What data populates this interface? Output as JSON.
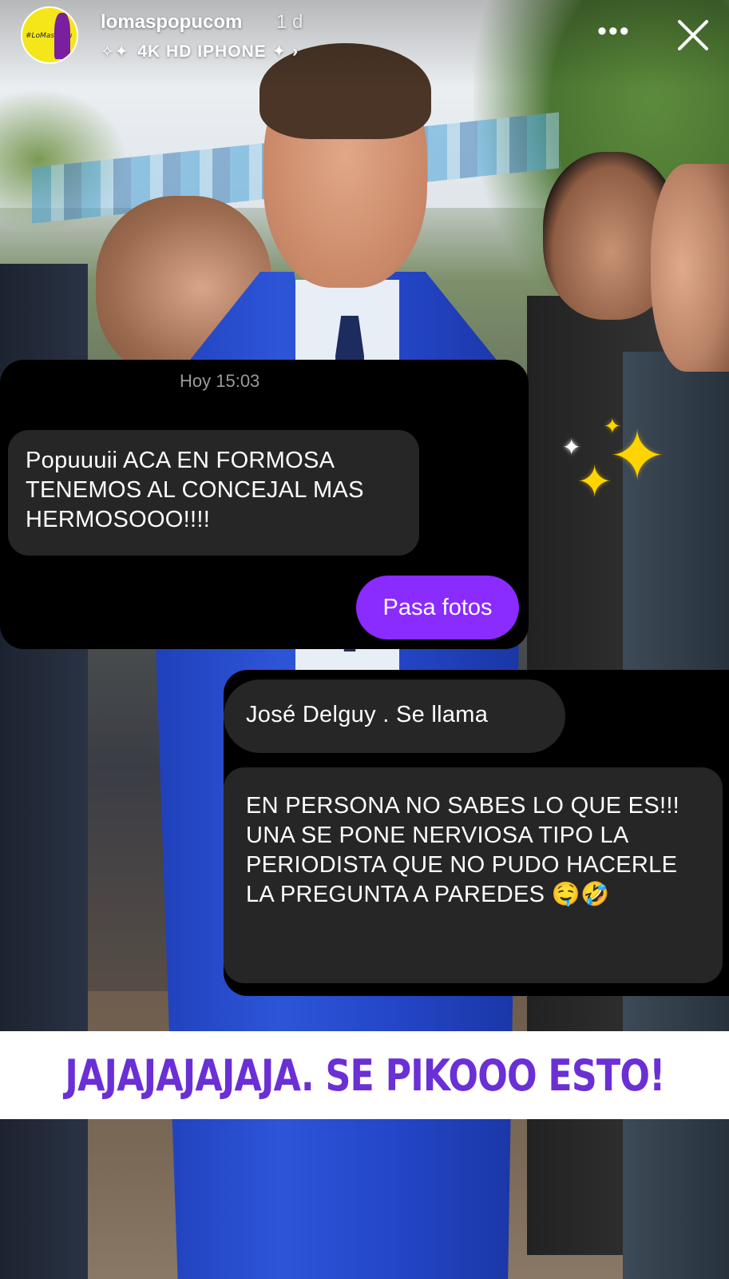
{
  "story": {
    "username": "lomaspopucom",
    "time_ago": "1 d",
    "music_label": "4K HD IPHONE",
    "avatar_text": "#LoMasPopu"
  },
  "chat": {
    "timestamp": "Hoy 15:03",
    "message_1": "Popuuuii ACA EN FORMOSA TENEMOS AL CONCEJAL MAS HERMOSOOO!!!!",
    "reply": "Pasa fotos",
    "message_2": "José Delguy . Se llama",
    "message_3": "EN PERSONA NO SABES LO QUE ES!!! UNA SE PONE NERVIOSA TIPO LA PERIODISTA  QUE NO PUDO HACERLE LA PREGUNTA A PAREDES 🤤🤣"
  },
  "banner": {
    "text": "JAJAJAJAJAJA.  SE PIKOOO ESTO!"
  },
  "colors": {
    "accent_purple": "#8a2bff",
    "banner_text": "#6b2fd6",
    "bubble_bg": "#262626",
    "avatar_bg": "#f5e61a"
  },
  "icons": [
    "more-options-icon",
    "close-icon",
    "sparkle-icon",
    "music-sparkle-icon"
  ]
}
